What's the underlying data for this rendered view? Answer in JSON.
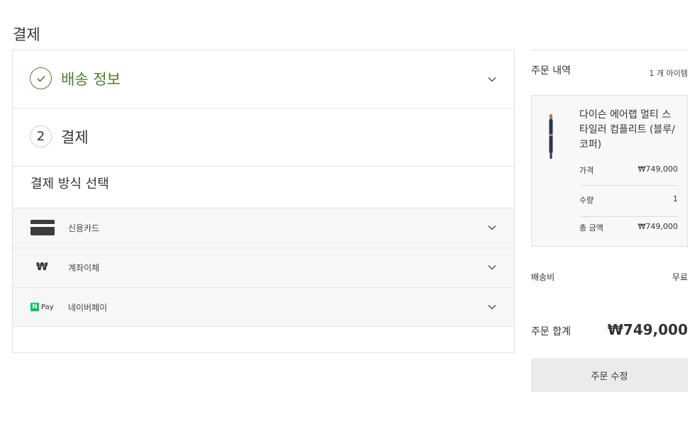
{
  "page": {
    "title": "결제"
  },
  "steps": [
    {
      "label": "배송 정보",
      "state": "complete",
      "icon": "check-circle-icon"
    },
    {
      "number": "2",
      "label": "결제",
      "state": "active"
    }
  ],
  "payment": {
    "title": "결제 방식 선택",
    "methods": [
      {
        "label": "신용카드",
        "icon": "credit-card-icon"
      },
      {
        "label": "계좌이체",
        "icon": "won-icon",
        "glyph": "₩"
      },
      {
        "label": "네이버페이",
        "icon": "naver-pay-icon",
        "logo_letter": "N",
        "logo_text": "Pay"
      }
    ]
  },
  "summary": {
    "title": "주문 내역",
    "item_count": "1 개 아이템",
    "item": {
      "name": "다이슨 에어랩 멀티 스타일러 컴플리트 (블루/코퍼)",
      "price_label": "가격",
      "price": "₩749,000",
      "qty_label": "수량",
      "qty": "1",
      "total_label": "총 금액",
      "total": "₩749,000"
    },
    "shipping_label": "배송비",
    "shipping_value": "무료",
    "order_total_label": "주문 합계",
    "order_total": "₩749,000",
    "edit_button": "주문 수정"
  },
  "colors": {
    "accent_green": "#4a7f2a",
    "naver_green": "#03c75a",
    "border": "#e0e0e0",
    "button_bg": "#ebebeb"
  }
}
